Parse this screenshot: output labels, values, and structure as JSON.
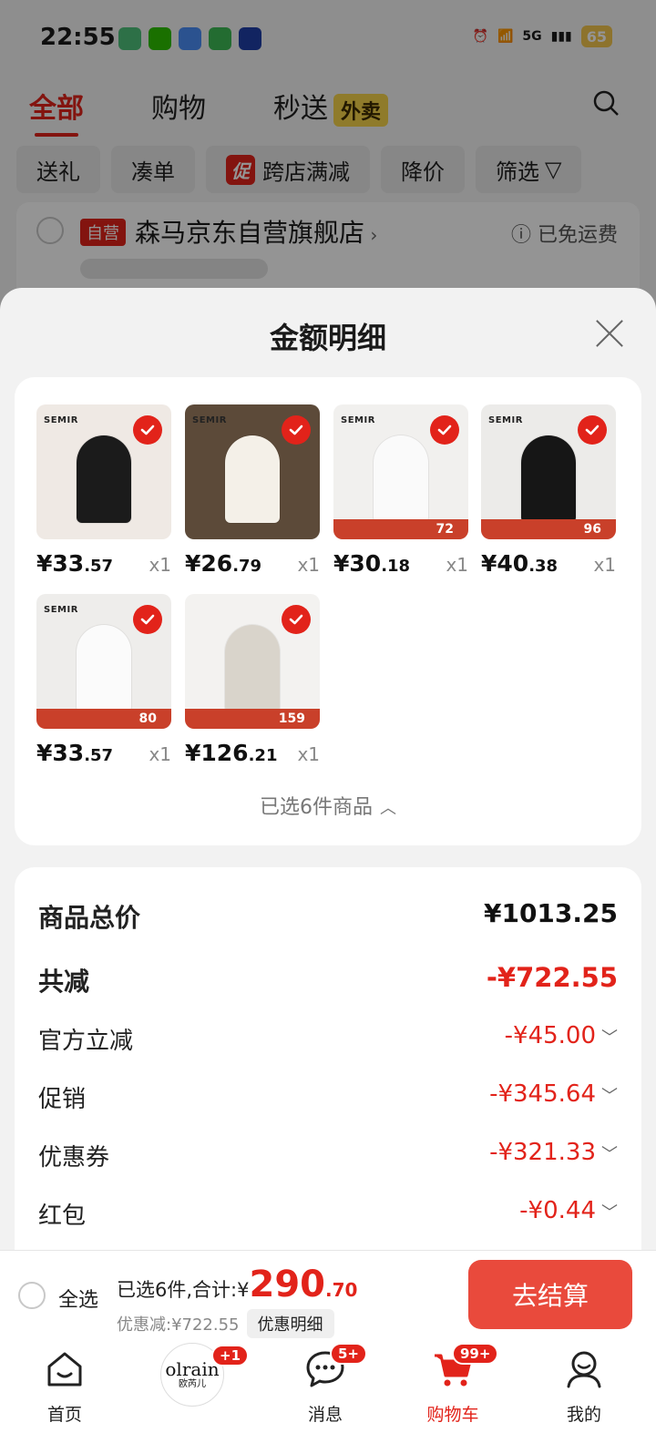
{
  "status_bar": {
    "time": "22:55",
    "network": "5G",
    "battery": "65"
  },
  "top_tabs": {
    "all": "全部",
    "shopping": "购物",
    "express": "秒送",
    "waimai": "外卖"
  },
  "chips": {
    "gift": "送礼",
    "make_order": "凑单",
    "promo_tag": "促",
    "cross_store": "跨店满减",
    "price_drop": "降价",
    "filter": "筛选"
  },
  "store": {
    "tag": "自营",
    "name": "森马京东自营旗舰店",
    "free_shipping": "已免运费"
  },
  "sheet": {
    "title": "金额明细",
    "selected_count": "已选6件商品",
    "products": [
      {
        "price_int": "¥33",
        "price_dec": ".57",
        "qty": "x1",
        "brand": "SEMIR",
        "bg": "#efe9e4",
        "accent": "#1b1b1b"
      },
      {
        "price_int": "¥26",
        "price_dec": ".79",
        "qty": "x1",
        "brand": "SEMIR",
        "bg": "#5c4a39",
        "accent": "#f4f0e8"
      },
      {
        "price_int": "¥30",
        "price_dec": ".18",
        "qty": "x1",
        "brand": "SEMIR",
        "bg": "#f1f0ee",
        "accent": "#fafafa",
        "promo": "72"
      },
      {
        "price_int": "¥40",
        "price_dec": ".38",
        "qty": "x1",
        "brand": "SEMIR",
        "bg": "#ecebe9",
        "accent": "#161616",
        "promo": "96"
      },
      {
        "price_int": "¥33",
        "price_dec": ".57",
        "qty": "x1",
        "brand": "SEMIR",
        "bg": "#eeedeb",
        "accent": "#fbfbfb",
        "promo": "80"
      },
      {
        "price_int": "¥126",
        "price_dec": ".21",
        "qty": "x1",
        "brand": "",
        "bg": "#f3f2f0",
        "accent": "#d9d4cb",
        "promo": "159"
      }
    ],
    "summary": {
      "subtotal_label": "商品总价",
      "subtotal_value": "¥1013.25",
      "total_discount_label": "共减",
      "total_discount_value": "-¥722.55",
      "official_label": "官方立减",
      "official_value": "-¥45.00",
      "promo_label": "促销",
      "promo_value": "-¥345.64",
      "coupon_label": "优惠券",
      "coupon_value": "-¥321.33",
      "redpacket_label": "红包",
      "redpacket_value": "-¥0.44"
    }
  },
  "checkout": {
    "select_all": "全选",
    "total_prefix": "已选6件,合计:¥",
    "total_int": "290",
    "total_dec": ".70",
    "discount_text": "优惠减:¥722.55",
    "detail_button": "优惠明细",
    "pay_button": "去结算"
  },
  "nav": {
    "home": "首页",
    "brand_top": "olrain",
    "brand_bottom": "欧芮儿",
    "brand_badge": "+1",
    "messages": "消息",
    "messages_badge": "5+",
    "cart": "购物车",
    "cart_badge": "99+",
    "me": "我的"
  },
  "colors": {
    "accent": "#e2231a",
    "pay_button": "#e94a3c"
  }
}
